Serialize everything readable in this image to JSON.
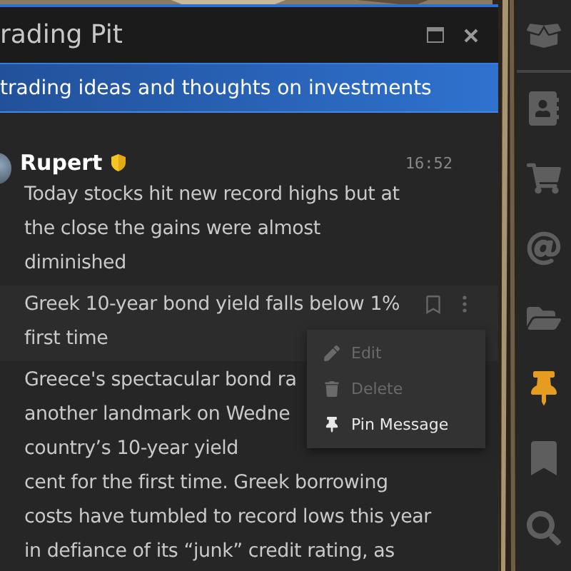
{
  "window": {
    "title": "rading Pit"
  },
  "banner": "trading ideas and thoughts on investments",
  "messages": [
    {
      "author": "Rupert",
      "time": "16:52",
      "lines": [
        "Today stocks hit new record highs but at",
        "the close the gains were almost",
        "diminished"
      ]
    },
    {
      "hovered": true,
      "lines": [
        "Greek 10-year bond yield falls below 1%",
        "first time"
      ]
    },
    {
      "lines": [
        "Greece's spectacular bond ra",
        "another landmark on Wedne",
        "country’s 10-year yield",
        "cent for the first time. Greek borrowing",
        "costs have tumbled to record lows this year",
        "in defiance of its “junk” credit rating, as"
      ]
    }
  ],
  "context_menu": [
    {
      "kind": "edit",
      "label": "Edit",
      "disabled": true
    },
    {
      "kind": "delete",
      "label": "Delete",
      "disabled": true
    },
    {
      "kind": "pin",
      "label": "Pin Message",
      "disabled": false
    }
  ],
  "sidebar": [
    {
      "kind": "box",
      "selected": false
    },
    {
      "kind": "contacts",
      "selected": false
    },
    {
      "kind": "cart",
      "selected": false
    },
    {
      "kind": "mention",
      "selected": false
    },
    {
      "kind": "folder",
      "selected": false
    },
    {
      "kind": "pin",
      "selected": true
    },
    {
      "kind": "bookmark",
      "selected": false
    },
    {
      "kind": "search",
      "selected": false
    }
  ]
}
